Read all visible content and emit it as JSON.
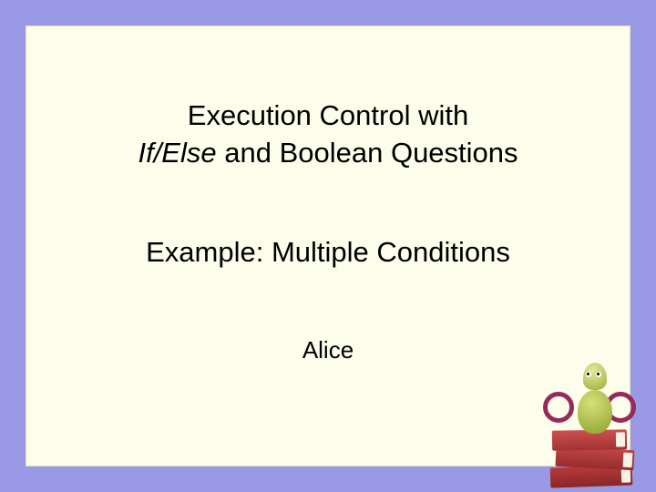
{
  "title": {
    "line1": "Execution Control with",
    "line2_italic": "If/Else",
    "line2_rest": " and Boolean Questions"
  },
  "subtitle": "Example: Multiple Conditions",
  "author": "Alice"
}
